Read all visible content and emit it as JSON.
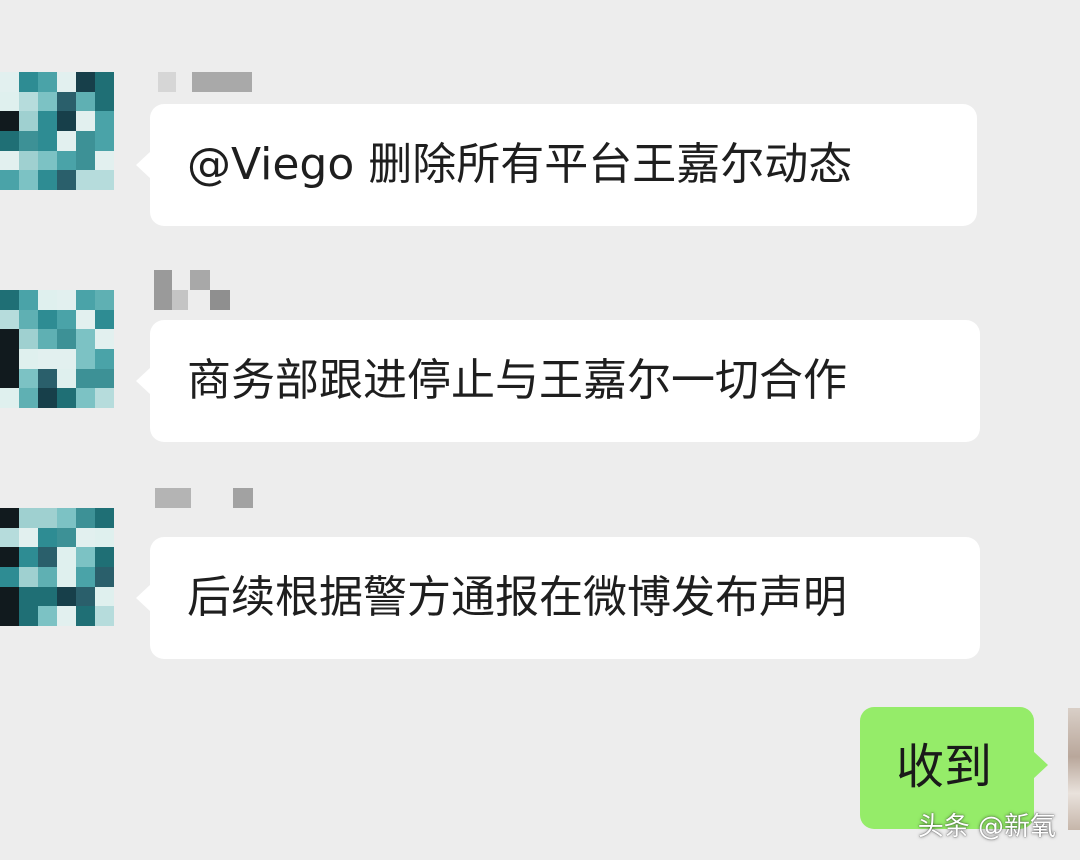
{
  "chat": {
    "messages": [
      {
        "text": "@Viego 删除所有平台王嘉尔动态"
      },
      {
        "text": "商务部跟进停止与王嘉尔一切合作"
      },
      {
        "text": "后续根据警方通报在微博发布声明"
      }
    ],
    "reply": {
      "text": "收到"
    }
  },
  "watermark": {
    "text": "头条 @新氧"
  },
  "colors": {
    "background": "#ededed",
    "incoming_bubble": "#ffffff",
    "outgoing_bubble": "#95ec69"
  }
}
